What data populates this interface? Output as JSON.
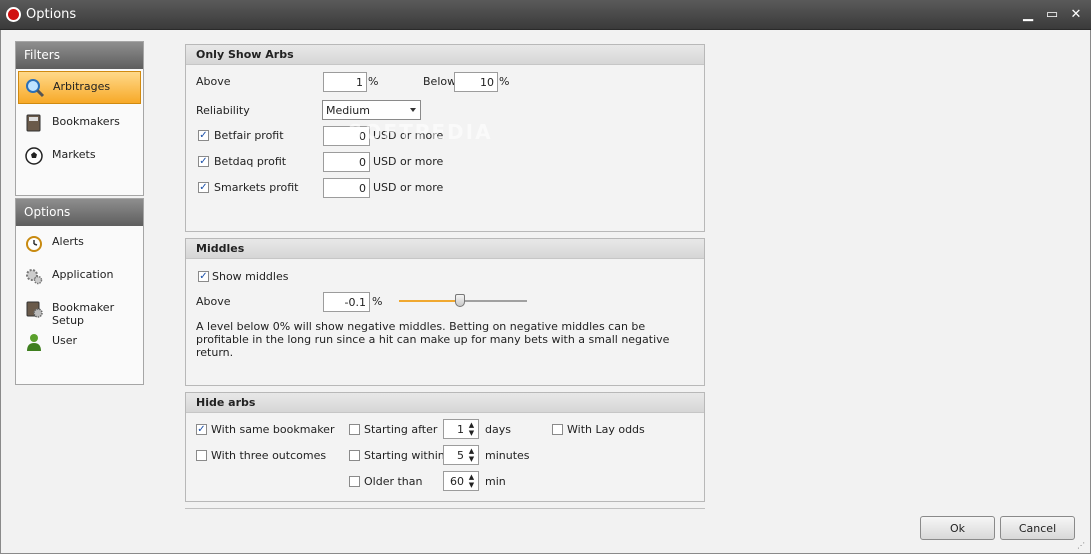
{
  "window": {
    "title": "Options",
    "minimize_glyph": "▁",
    "maximize_glyph": "▭",
    "close_glyph": "✕"
  },
  "sidebar": {
    "filters_title": "Filters",
    "filters": [
      {
        "label": "Arbitrages",
        "icon": "magnifier-icon"
      },
      {
        "label": "Bookmakers",
        "icon": "book-icon"
      },
      {
        "label": "Markets",
        "icon": "soccer-ball-icon"
      }
    ],
    "options_title": "Options",
    "options": [
      {
        "label": "Alerts",
        "icon": "alarm-clock-icon"
      },
      {
        "label": "Application",
        "icon": "gears-icon"
      },
      {
        "label": "Bookmaker Setup",
        "icon": "setup-icon"
      },
      {
        "label": "User",
        "icon": "user-icon"
      }
    ]
  },
  "only_show_arbs": {
    "title": "Only Show Arbs",
    "above_label": "Above",
    "above_value": "1",
    "percent": "%",
    "below_label": "Below",
    "below_value": "10",
    "reliability_label": "Reliability",
    "reliability_value": "Medium",
    "profits": [
      {
        "label": "Betfair profit",
        "checked": true,
        "value": "0",
        "unit": "USD or more"
      },
      {
        "label": "Betdaq profit",
        "checked": true,
        "value": "0",
        "unit": "USD or more"
      },
      {
        "label": "Smarkets profit",
        "checked": true,
        "value": "0",
        "unit": "USD or more"
      }
    ]
  },
  "middles": {
    "title": "Middles",
    "show_middles_label": "Show middles",
    "show_middles_checked": true,
    "above_label": "Above",
    "above_value": "-0.1",
    "percent": "%",
    "slider_level": 0.48,
    "description": "A level below 0% will show negative middles. Betting on negative middles can be profitable in the long run since a hit can make up for many bets with a small negative return."
  },
  "hide_arbs": {
    "title": "Hide arbs",
    "same_bookmaker_label": "With same bookmaker",
    "same_bookmaker_checked": true,
    "three_outcomes_label": "With three outcomes",
    "three_outcomes_checked": false,
    "starting_after_label": "Starting after",
    "starting_after_value": "1",
    "starting_after_unit": "days",
    "starting_within_label": "Starting within",
    "starting_within_value": "5",
    "starting_within_unit": "minutes",
    "older_than_label": "Older than",
    "older_than_value": "60",
    "older_than_unit": "min",
    "lay_odds_label": "With Lay odds",
    "lay_odds_checked": false
  },
  "buttons": {
    "ok": "Ok",
    "cancel": "Cancel"
  },
  "watermark": "SOFTPEDIA",
  "colors": {
    "accent": "#f7a928",
    "titlebar": "#3a3a3a"
  }
}
